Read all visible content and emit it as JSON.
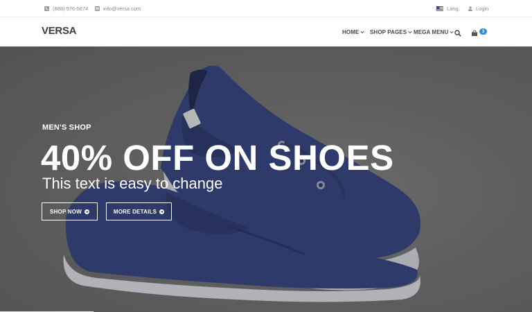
{
  "topbar": {
    "phone": "(888) 576-5674",
    "email": "info@versa.com",
    "lang_label": "Lang.",
    "login_label": "Login"
  },
  "header": {
    "logo": "VERSA",
    "nav": [
      {
        "label": "HOME"
      },
      {
        "label": "SHOP PAGES"
      },
      {
        "label": "MEGA MENU"
      }
    ],
    "cart_count": "3"
  },
  "hero": {
    "eyebrow": "MEN'S SHOP",
    "headline": "40% OFF ON SHOES",
    "subline": "This text is easy to change",
    "buttons": [
      {
        "label": "SHOP NOW"
      },
      {
        "label": "MORE DETAILS"
      }
    ]
  },
  "colors": {
    "accent": "#2f8fd1",
    "shoe": "#2f3f79",
    "background": "#6b6b6b"
  },
  "icons": [
    "phone-icon",
    "mail-icon",
    "us-flag-icon",
    "user-icon",
    "chevron-down-icon",
    "search-icon",
    "cart-icon",
    "circle-arrow-right-icon"
  ]
}
